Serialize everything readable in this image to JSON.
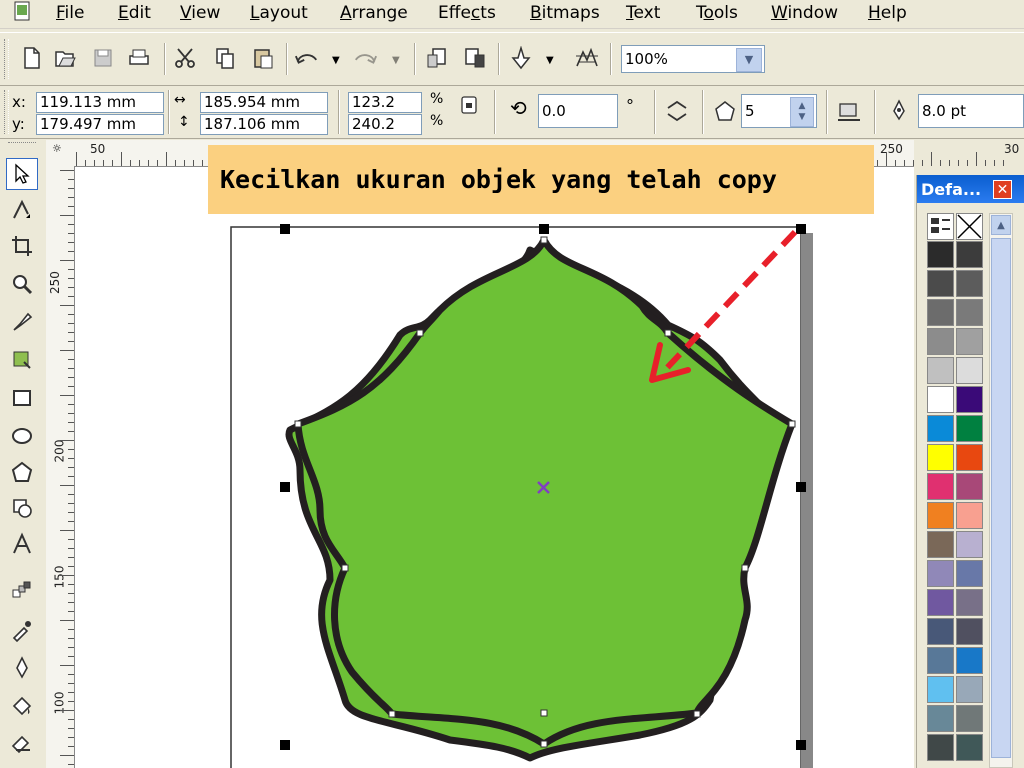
{
  "menu": {
    "items": [
      {
        "key": "file",
        "pre": "",
        "ul": "F",
        "post": "ile"
      },
      {
        "key": "edit",
        "pre": "",
        "ul": "E",
        "post": "dit"
      },
      {
        "key": "view",
        "pre": "",
        "ul": "V",
        "post": "iew"
      },
      {
        "key": "layout",
        "pre": "",
        "ul": "L",
        "post": "ayout"
      },
      {
        "key": "arrange",
        "pre": "",
        "ul": "A",
        "post": "rrange"
      },
      {
        "key": "effects",
        "pre": "Effe",
        "ul": "c",
        "post": "ts"
      },
      {
        "key": "bitmaps",
        "pre": "",
        "ul": "B",
        "post": "itmaps"
      },
      {
        "key": "text",
        "pre": "",
        "ul": "T",
        "post": "ext"
      },
      {
        "key": "tools",
        "pre": "T",
        "ul": "o",
        "post": "ols"
      },
      {
        "key": "window",
        "pre": "",
        "ul": "W",
        "post": "indow"
      },
      {
        "key": "help",
        "pre": "",
        "ul": "H",
        "post": "elp"
      }
    ]
  },
  "toolbar": {
    "zoom_value": "100%"
  },
  "property_bar": {
    "x_label": "x:",
    "x_value": "119.113 mm",
    "y_label": "y:",
    "y_value": "179.497 mm",
    "width_value": "185.954 mm",
    "height_value": "187.106 mm",
    "scale_x": "123.2",
    "scale_y": "240.2",
    "percent_symbol": "%",
    "rotation_value": "0.0",
    "degree_symbol": "°",
    "sides_value": "5",
    "outline_value": "8.0 pt"
  },
  "rulers": {
    "horizontal_ticks": [
      "50",
      "250",
      "30"
    ],
    "vertical_ticks": [
      "250",
      "200",
      "150",
      "100"
    ]
  },
  "callout": {
    "text": "Kecilkan ukuran objek yang telah copy"
  },
  "palette": {
    "title": "Defa...",
    "colors": [
      "#2b2b2b",
      "#3c3c3c",
      "#4b4b4b",
      "#5c5c5c",
      "#6c6c6c",
      "#7a7a7a",
      "#8c8c8c",
      "#a0a0a0",
      "#c0c0c0",
      "#dcdcdc",
      "#ffffff",
      "#3a0a78",
      "#0a8ad8",
      "#008040",
      "#ffff00",
      "#e84810",
      "#e03070",
      "#a84878",
      "#f08020",
      "#f8a090",
      "#7a6858",
      "#b8b0d0",
      "#9088b8",
      "#6878a8",
      "#7058a0",
      "#787088",
      "#485878",
      "#505060",
      "#587898",
      "#1878c8",
      "#60c0f0",
      "#98a8b8",
      "#688898",
      "#707878",
      "#404848",
      "#405858"
    ],
    "accent": "#2b7cf0"
  },
  "canvas": {
    "shape_fill": "#6dc136",
    "shape_outline": "#231f20",
    "arrow_color": "#e8202a",
    "center_mark_color": "#8040c0"
  }
}
